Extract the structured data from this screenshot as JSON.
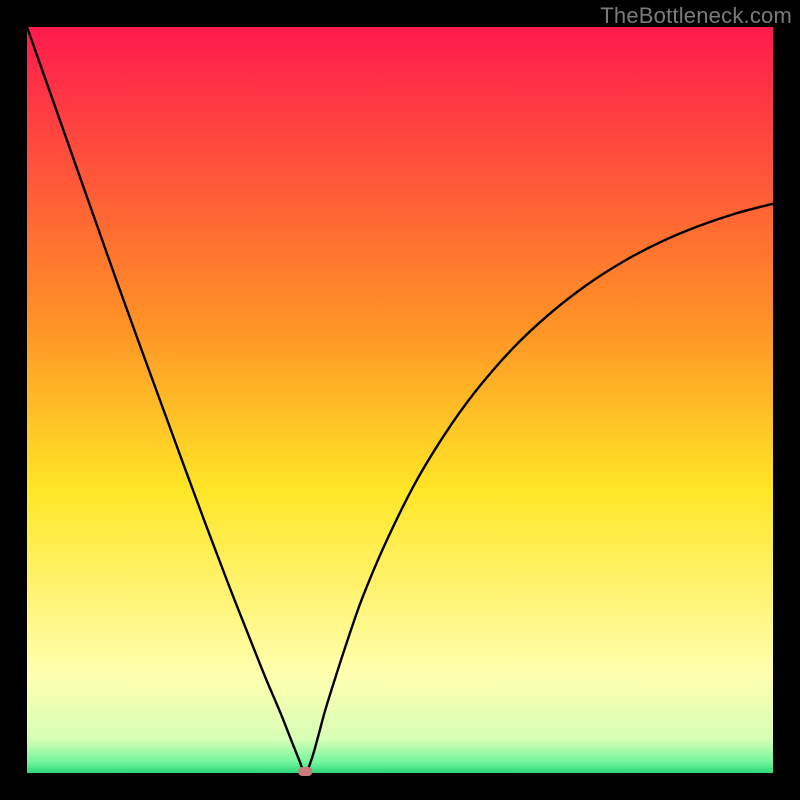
{
  "watermark": "TheBottleneck.com",
  "colors": {
    "frame": "#000000",
    "gradient_stops": [
      {
        "pos": 0.0,
        "color": "#ff1a4d"
      },
      {
        "pos": 0.4,
        "color": "#ff9326"
      },
      {
        "pos": 0.62,
        "color": "#ffe626"
      },
      {
        "pos": 0.87,
        "color": "#ffffb0"
      },
      {
        "pos": 0.955,
        "color": "#d6ffb5"
      },
      {
        "pos": 0.985,
        "color": "#75f59e"
      },
      {
        "pos": 1.0,
        "color": "#2bd878"
      }
    ],
    "curve": "#000000",
    "marker": "#c97a7a"
  },
  "chart_data": {
    "type": "line",
    "title": "",
    "xlabel": "",
    "ylabel": "",
    "xlim": [
      0,
      100
    ],
    "ylim": [
      0,
      100
    ],
    "categories_note": "x is horizontal position (0=left,100=right); y is bottleneck % (0=bottom,100=top)",
    "marker": {
      "x": 37.3,
      "y": 0.0
    },
    "series": [
      {
        "name": "bottleneck-curve",
        "x": [
          0,
          3,
          6,
          9,
          12,
          15,
          18,
          21,
          24,
          27,
          30,
          32,
          34,
          35.5,
          36.5,
          37.3,
          38.2,
          39,
          40,
          41.5,
          43,
          45,
          48,
          52,
          56,
          60,
          65,
          70,
          75,
          80,
          85,
          90,
          95,
          100
        ],
        "values": [
          100,
          91.5,
          83,
          74.5,
          66,
          57.7,
          49.5,
          41.3,
          33.2,
          25.3,
          17.7,
          12.7,
          8.0,
          4.2,
          1.7,
          0.0,
          2.0,
          4.8,
          8.5,
          13.3,
          17.9,
          23.6,
          30.7,
          38.8,
          45.4,
          51.0,
          56.8,
          61.5,
          65.4,
          68.6,
          71.2,
          73.3,
          75.0,
          76.3
        ]
      }
    ]
  }
}
